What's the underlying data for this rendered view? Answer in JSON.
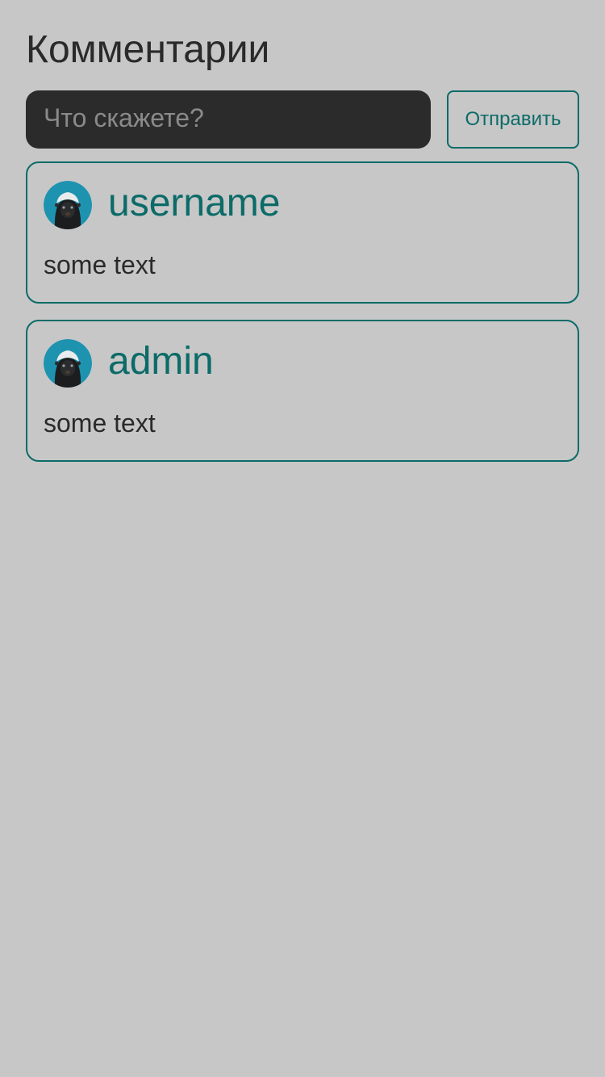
{
  "header": {
    "title": "Комментарии"
  },
  "composer": {
    "placeholder": "Что скажете?",
    "value": "",
    "send_label": "Отправить"
  },
  "comments": [
    {
      "author": "username",
      "text": "some text",
      "avatar_icon": "honey-badger-avatar"
    },
    {
      "author": "admin",
      "text": "some text",
      "avatar_icon": "honey-badger-avatar"
    }
  ],
  "colors": {
    "background": "#c7c7c7",
    "accent": "#0b6b68",
    "input_background": "#2b2b2b",
    "text": "#2a2a2a",
    "avatar_background": "#1e93b0"
  }
}
